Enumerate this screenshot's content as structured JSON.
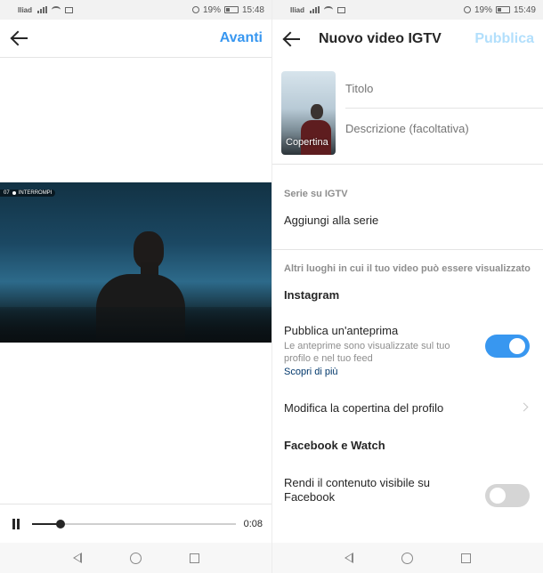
{
  "status_left": {
    "carrier": "Iliad",
    "battery": "19%",
    "time": "15:48"
  },
  "status_right": {
    "carrier": "Iliad",
    "battery": "19%",
    "time": "15:49"
  },
  "left_screen": {
    "next_label": "Avanti",
    "video_badge": {
      "timecode": "07",
      "text": "INTERROMPI"
    },
    "player": {
      "time": "0:08",
      "progress": 0.14
    }
  },
  "right_screen": {
    "title": "Nuovo video IGTV",
    "publish_label": "Pubblica",
    "cover_label": "Copertina",
    "title_placeholder": "Titolo",
    "description_placeholder": "Descrizione (facoltativa)",
    "series_section_label": "Serie su IGTV",
    "add_to_series": "Aggiungi alla serie",
    "other_places_label": "Altri luoghi in cui il tuo video può essere visualizzato",
    "instagram_heading": "Instagram",
    "preview_title": "Pubblica un'anteprima",
    "preview_description": "Le anteprime sono visualizzate sul tuo profilo e nel tuo feed",
    "learn_more": "Scopri di più",
    "preview_enabled": true,
    "edit_profile_cover": "Modifica la copertina del profilo",
    "facebook_heading": "Facebook e Watch",
    "facebook_visibility": "Rendi il contenuto visibile su Facebook",
    "facebook_enabled": false
  },
  "icons": {
    "back": "arrow-left-icon",
    "pause": "pause-icon",
    "nav_back": "triangle-back-icon",
    "nav_home": "circle-home-icon",
    "nav_recent": "square-recent-icon"
  },
  "colors": {
    "accent": "#3897f0",
    "accent_disabled": "#b2dffc",
    "link": "#00376b"
  }
}
